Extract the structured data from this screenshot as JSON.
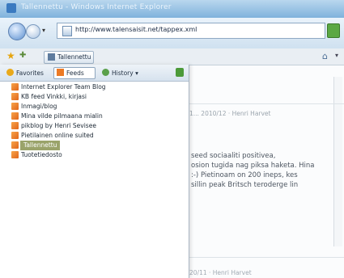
{
  "window": {
    "title": "Tallennettu - Windows Internet Explorer"
  },
  "address_bar": {
    "url": "http://www.talensaisit.net/tappex.xml"
  },
  "toolbar": {
    "tab_label": "Tallennettu"
  },
  "favorites_center": {
    "tabs": [
      {
        "label": "Favorites",
        "icon": "star-icon"
      },
      {
        "label": "Feeds",
        "icon": "rss-icon"
      },
      {
        "label": "History",
        "icon": "history-icon"
      }
    ],
    "feeds": [
      "Internet Explorer Team Blog",
      "KB feed Vinkki, kirjasi",
      "Inmagi/blog",
      "Mina vilde pilmaana mialin",
      "pikblog by Henri Sevisee",
      "Pietilainen online suited",
      "Tallennettu",
      "Tuotetiedosto"
    ],
    "selected_index": 6
  },
  "article": {
    "meta": "1... 2010/12 · Henri Harvet",
    "lines": [
      "seed sociaaliti positivea,",
      "osion tugida nag piksa haketa. Hina",
      ":-) Pietinoam on 200 ineps, kes",
      "sillin peak Britsch teroderge lin"
    ],
    "next_meta": "20/11 · Henri Harvet"
  }
}
